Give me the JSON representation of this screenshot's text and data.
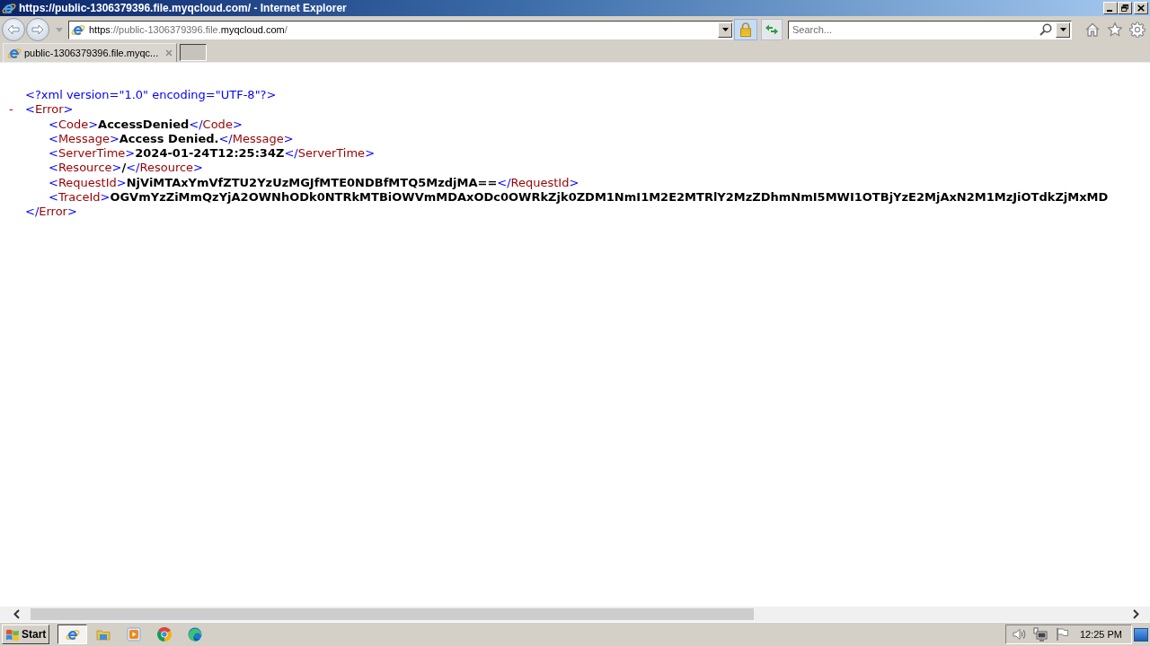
{
  "window": {
    "title": "https://public-1306379396.file.myqcloud.com/ - Internet Explorer"
  },
  "address_bar": {
    "url": {
      "scheme": "https",
      "before_domain": "://public-1306379396.file.",
      "domain": "myqcloud.com",
      "after_domain": "/"
    },
    "secure": true
  },
  "search": {
    "placeholder": "Search..."
  },
  "tabs": [
    {
      "label": "public-1306379396.file.myqc...",
      "selected": true
    }
  ],
  "document": {
    "declaration": [
      {
        "kind": "pi",
        "text": "<?xml version=\"1.0\" encoding=\"UTF-8\"?>"
      }
    ],
    "elements": [
      {
        "expanded": true,
        "toggle": "-",
        "open_line": [
          {
            "kind": "markup",
            "text": "<"
          },
          {
            "kind": "name",
            "text": "Error"
          },
          {
            "kind": "markup",
            "text": ">"
          }
        ],
        "children": [
          {
            "line": [
              {
                "kind": "markup",
                "text": "<"
              },
              {
                "kind": "name",
                "text": "Code"
              },
              {
                "kind": "markup",
                "text": ">"
              },
              {
                "kind": "value",
                "text": "AccessDenied"
              },
              {
                "kind": "markup",
                "text": "</"
              },
              {
                "kind": "name",
                "text": "Code"
              },
              {
                "kind": "markup",
                "text": ">"
              }
            ]
          },
          {
            "line": [
              {
                "kind": "markup",
                "text": "<"
              },
              {
                "kind": "name",
                "text": "Message"
              },
              {
                "kind": "markup",
                "text": ">"
              },
              {
                "kind": "value",
                "text": "Access Denied."
              },
              {
                "kind": "markup",
                "text": "</"
              },
              {
                "kind": "name",
                "text": "Message"
              },
              {
                "kind": "markup",
                "text": ">"
              }
            ]
          },
          {
            "line": [
              {
                "kind": "markup",
                "text": "<"
              },
              {
                "kind": "name",
                "text": "ServerTime"
              },
              {
                "kind": "markup",
                "text": ">"
              },
              {
                "kind": "value",
                "text": "2024-01-24T12:25:34Z"
              },
              {
                "kind": "markup",
                "text": "</"
              },
              {
                "kind": "name",
                "text": "ServerTime"
              },
              {
                "kind": "markup",
                "text": ">"
              }
            ]
          },
          {
            "line": [
              {
                "kind": "markup",
                "text": "<"
              },
              {
                "kind": "name",
                "text": "Resource"
              },
              {
                "kind": "markup",
                "text": ">"
              },
              {
                "kind": "value",
                "text": "/"
              },
              {
                "kind": "markup",
                "text": "</"
              },
              {
                "kind": "name",
                "text": "Resource"
              },
              {
                "kind": "markup",
                "text": ">"
              }
            ]
          },
          {
            "line": [
              {
                "kind": "markup",
                "text": "<"
              },
              {
                "kind": "name",
                "text": "RequestId"
              },
              {
                "kind": "markup",
                "text": ">"
              },
              {
                "kind": "value",
                "text": "NjViMTAxYmVfZTU2YzUzMGJfMTE0NDBfMTQ5MzdjMA=="
              },
              {
                "kind": "markup",
                "text": "</"
              },
              {
                "kind": "name",
                "text": "RequestId"
              },
              {
                "kind": "markup",
                "text": ">"
              }
            ]
          },
          {
            "line": [
              {
                "kind": "markup",
                "text": "<"
              },
              {
                "kind": "name",
                "text": "TraceId"
              },
              {
                "kind": "markup",
                "text": ">"
              },
              {
                "kind": "value",
                "text": "OGVmYzZiMmQzYjA2OWNhODk0NTRkMTBiOWVmMDAxODc0OWRkZjk0ZDM1NmI1M2E2MTRlY2MzZDhmNmI5MWI1OTBjYzE2MjAxN2M1MzJiOTdkZjMxMD"
              }
            ]
          }
        ],
        "close_line": [
          {
            "kind": "markup",
            "text": "</"
          },
          {
            "kind": "name",
            "text": "Error"
          },
          {
            "kind": "markup",
            "text": ">"
          }
        ]
      }
    ]
  },
  "taskbar": {
    "start_label": "Start",
    "items": [
      {
        "kind": "ie",
        "selected": true
      },
      {
        "kind": "folder",
        "selected": false
      },
      {
        "kind": "player",
        "selected": false
      },
      {
        "kind": "chrome",
        "selected": false
      },
      {
        "kind": "edge",
        "selected": false
      }
    ],
    "clock": "12:25 PM"
  }
}
